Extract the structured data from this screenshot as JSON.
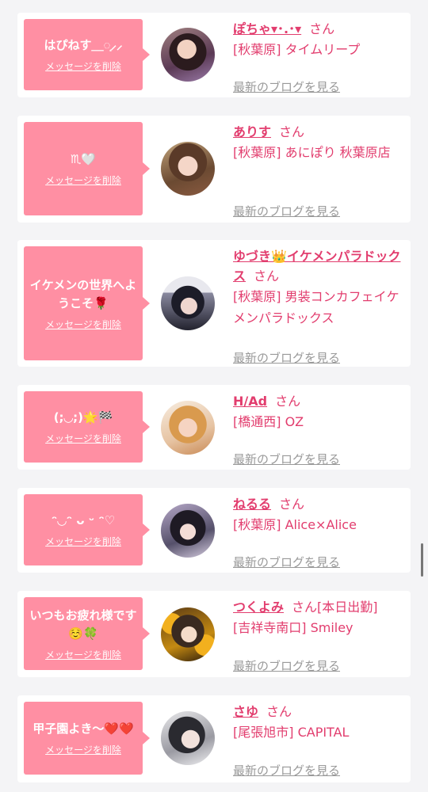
{
  "delete_label": "メッセージを削除",
  "blog_label": "最新のブログを見る",
  "colors": {
    "accent": "#e23d6e",
    "bubble": "#ff8fa3",
    "background": "#f4f4f6"
  },
  "cards": [
    {
      "message": "はぴねす＿◌͙⸝⸝",
      "name": "ぽちゃ▾･.･▾",
      "suffix": "さん",
      "shop": "[秋葉原] タイムリープ"
    },
    {
      "message": "♏🤍",
      "name": "ありす",
      "suffix": "さん",
      "shop": "[秋葉原] あにぽり 秋葉原店"
    },
    {
      "message": "イケメンの世界へようこそ🌹",
      "name": "ゆづき👑イケメンパラドックス",
      "suffix": "さん",
      "shop": "[秋葉原] 男装コンカフェイケメンパラドックス"
    },
    {
      "message": "(;◡;)🌟🏁",
      "name": "H/Ad",
      "suffix": "さん",
      "shop": "[橋通西] OZ"
    },
    {
      "message": "ᵔ◡ᵔ ᴗ ᵕ ᵔ♡",
      "name": "ねるる",
      "suffix": "さん",
      "shop": "[秋葉原] Alice×Alice"
    },
    {
      "message": "いつもお疲れ様です☺️🍀",
      "name": "つくよみ",
      "suffix": "さん[本日出勤]",
      "shop": "[吉祥寺南口] Smiley"
    },
    {
      "message": "甲子園よき〜❤️❤️",
      "name": "さゆ",
      "suffix": "さん",
      "shop": "[尾張旭市] CAPITAL"
    }
  ]
}
